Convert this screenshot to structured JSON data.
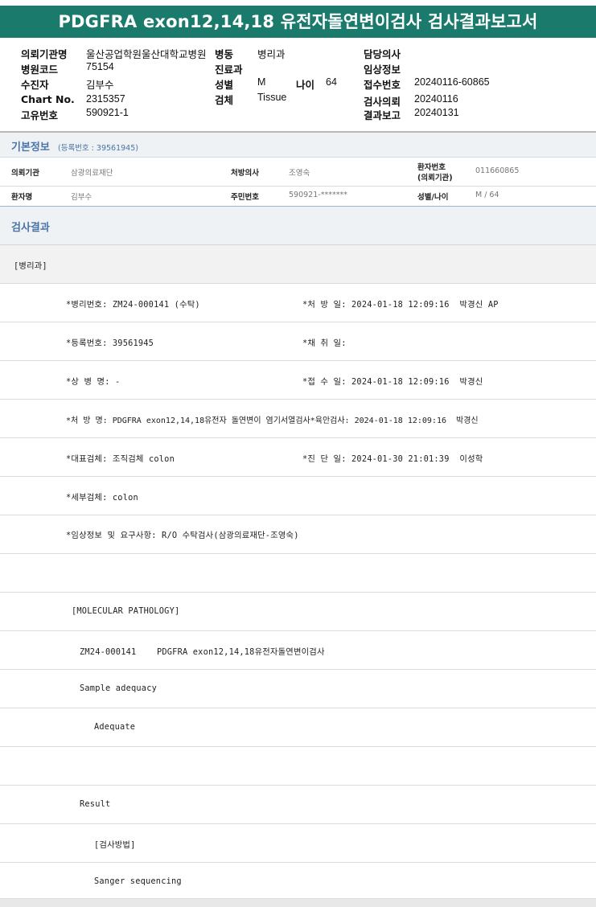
{
  "report": {
    "title": "PDGFRA exon12,14,18 유전자돌연변이검사 검사결과보고서"
  },
  "header": {
    "labels": {
      "institution": "의뢰기관명",
      "ward": "병동",
      "doctor": "담당의사",
      "hospital_code": "병원코드",
      "department": "진료과",
      "clinical_info": "임상정보",
      "recipient": "수진자",
      "sex": "성별",
      "age": "나이",
      "reception_no": "접수번호",
      "chart_no": "Chart No.",
      "specimen": "검체",
      "request_date": "검사의뢰",
      "unique_no": "고유번호",
      "report_date": "결과보고"
    },
    "values": {
      "institution": "울산공업학원울산대학교병원",
      "ward": "병리과",
      "hospital_code": "75154",
      "recipient": "김부수",
      "sex": "M",
      "age": "64",
      "reception_no": "20240116-60865",
      "chart_no": "2315357",
      "specimen": "Tissue",
      "request_date": "20240116",
      "unique_no": "590921-1",
      "report_date": "20240131"
    }
  },
  "basic_info": {
    "title": "기본정보",
    "reg_note": "(등록번호 : 39561945)",
    "rows": [
      [
        {
          "label": "의뢰기관",
          "value": "삼광의료재단"
        },
        {
          "label": "처방의사",
          "value": "조영숙"
        },
        {
          "label": "환자번호 (의뢰기관)",
          "label_line1": "환자번호",
          "label_line2": "(의뢰기관)",
          "value": "011660865"
        }
      ],
      [
        {
          "label": "환자명",
          "value": "김부수"
        },
        {
          "label": "주민번호",
          "value": "590921-*******"
        },
        {
          "label": "성별/나이",
          "value": "M / 64"
        }
      ]
    ]
  },
  "results": {
    "title": "검사결과",
    "dept": "[병리과]",
    "lines": [
      {
        "left": "*병리번호: ZM24-000141 (수탁)",
        "right": "*처 방 일: 2024-01-18 12:09:16  박경신 AP"
      },
      {
        "left": "*등록번호: 39561945",
        "right": "*채 취 일:"
      },
      {
        "left": "*상 병 명: -",
        "right": "*접 수 일: 2024-01-18 12:09:16  박경신"
      },
      {
        "left": "*처 방 명: PDGFRA exon12,14,18유전자 돌연변이 염기서열검사*육안검사: 2024-01-18 12:09:16  박경신",
        "right": ""
      },
      {
        "left": "*대표검체: 조직검체 colon",
        "right": "*진 단 일: 2024-01-30 21:01:39  이성학"
      },
      {
        "left": "*세부검체: colon",
        "right": ""
      },
      {
        "left": "*임상정보 및 요구사항: R/O 수탁검사(삼광의료재단-조영숙)",
        "right": ""
      }
    ],
    "molecular": [
      "[MOLECULAR PATHOLOGY]",
      "ZM24-000141    PDGFRA exon12,14,18유전자돌연변이검사",
      "Sample adequacy",
      "Adequate",
      "",
      "Result",
      "[검사방법]",
      "Sanger sequencing"
    ]
  }
}
